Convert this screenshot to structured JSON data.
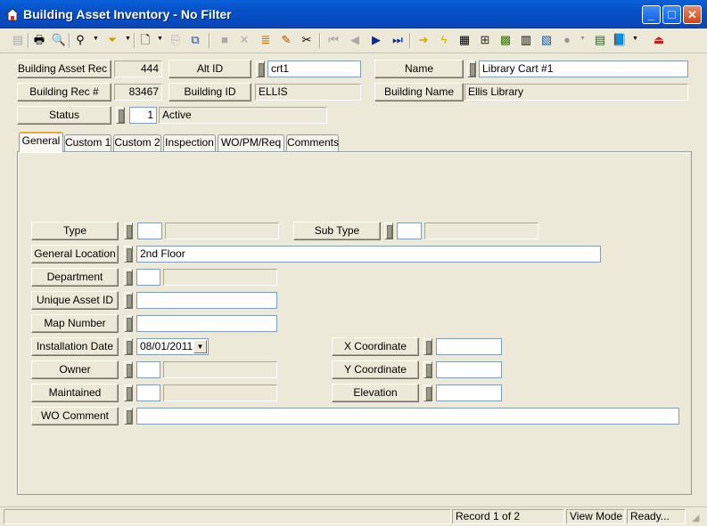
{
  "window": {
    "title": "Building Asset Inventory - No Filter",
    "minimize": "_",
    "maximize": "□",
    "close": "✕"
  },
  "toolbar": {
    "icons": [
      "save-icon",
      "print-icon",
      "print-preview-icon",
      "find-icon",
      "filter-icon",
      "new-record-icon",
      "copy-record-icon",
      "attach-icon",
      "stop-icon",
      "delete-icon",
      "stack-icon",
      "edit-icon",
      "cut-icon",
      "first-record-icon",
      "previous-record-icon",
      "next-record-icon",
      "last-record-icon",
      "jump-icon",
      "lightning-icon",
      "chart-icon",
      "org-chart-icon",
      "map-icon",
      "calculator-icon",
      "report-icon",
      "globe-icon",
      "spreadsheet-icon",
      "book-icon",
      "exit-icon"
    ]
  },
  "header": {
    "asset_rec_label": "Building Asset Rec #",
    "asset_rec_value": "444",
    "alt_id_label": "Alt ID",
    "alt_id_value": "crt1",
    "name_label": "Name",
    "name_value": "Library Cart #1",
    "building_rec_label": "Building Rec #",
    "building_rec_value": "83467",
    "building_id_label": "Building ID",
    "building_id_value": "ELLIS",
    "building_name_label": "Building Name",
    "building_name_value": "Ellis Library",
    "status_label": "Status",
    "status_code": "1",
    "status_value": "Active"
  },
  "tabs": [
    {
      "label": "General",
      "active": true
    },
    {
      "label": "Custom 1",
      "active": false
    },
    {
      "label": "Custom 2",
      "active": false
    },
    {
      "label": "Inspection",
      "active": false
    },
    {
      "label": "WO/PM/Req",
      "active": false
    },
    {
      "label": "Comments",
      "active": false
    }
  ],
  "general": {
    "type_label": "Type",
    "type_code": "",
    "type_desc": "",
    "sub_type_label": "Sub Type",
    "sub_type_code": "",
    "sub_type_desc": "",
    "general_location_label": "General Location",
    "general_location_value": "2nd Floor",
    "department_label": "Department",
    "department_code": "",
    "department_desc": "",
    "unique_asset_id_label": "Unique Asset ID",
    "unique_asset_id_value": "",
    "map_number_label": "Map Number",
    "map_number_value": "",
    "installation_date_label": "Installation Date",
    "installation_date_value": "08/01/2011",
    "owner_label": "Owner",
    "owner_code": "",
    "owner_desc": "",
    "maintained_label": "Maintained",
    "maintained_code": "",
    "maintained_desc": "",
    "wo_comment_label": "WO Comment",
    "wo_comment_value": "",
    "x_coordinate_label": "X Coordinate",
    "x_coordinate_value": "",
    "y_coordinate_label": "Y Coordinate",
    "y_coordinate_value": "",
    "elevation_label": "Elevation",
    "elevation_value": ""
  },
  "statusbar": {
    "record": "Record 1 of 2",
    "mode": "View Mode",
    "state": "Ready..."
  },
  "colors": {
    "titlebar": "#0450c8",
    "window_bg": "#ece9d8",
    "active_tab_accent": "#e6a93a"
  }
}
